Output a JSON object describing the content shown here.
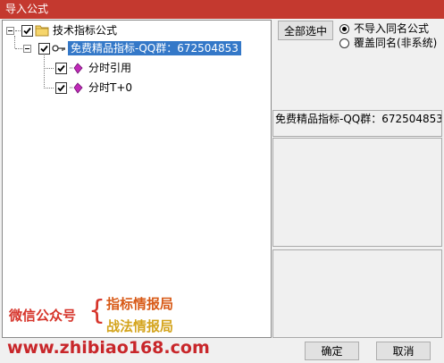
{
  "window": {
    "title": "导入公式"
  },
  "tree": {
    "root": {
      "label": "技术指标公式",
      "checked": true
    },
    "child": {
      "label": "免费精品指标-QQ群：672504853",
      "checked": true,
      "selected": true
    },
    "leaves": [
      {
        "label": "分时引用",
        "checked": true
      },
      {
        "label": "分时T+0",
        "checked": true
      }
    ]
  },
  "watermark": {
    "left": "微信公众号",
    "brace": "{",
    "line1": "指标情报局",
    "line2": "战法情报局",
    "website": "www.zhibiao168.com"
  },
  "options": {
    "select_all_label": "全部选中",
    "radios": [
      {
        "label": "不导入同名公式",
        "selected": true
      },
      {
        "label": "覆盖同名(非系统)",
        "selected": false
      }
    ]
  },
  "detail": {
    "name": "免费精品指标-QQ群：672504853"
  },
  "footer": {
    "ok_label": "确定",
    "cancel_label": "取消"
  },
  "colors": {
    "titlebar": "#c4392f",
    "selection": "#3478c8",
    "watermark_red": "#d6342a",
    "watermark_orange": "#d85a17",
    "watermark_gold": "#d4a41c"
  }
}
